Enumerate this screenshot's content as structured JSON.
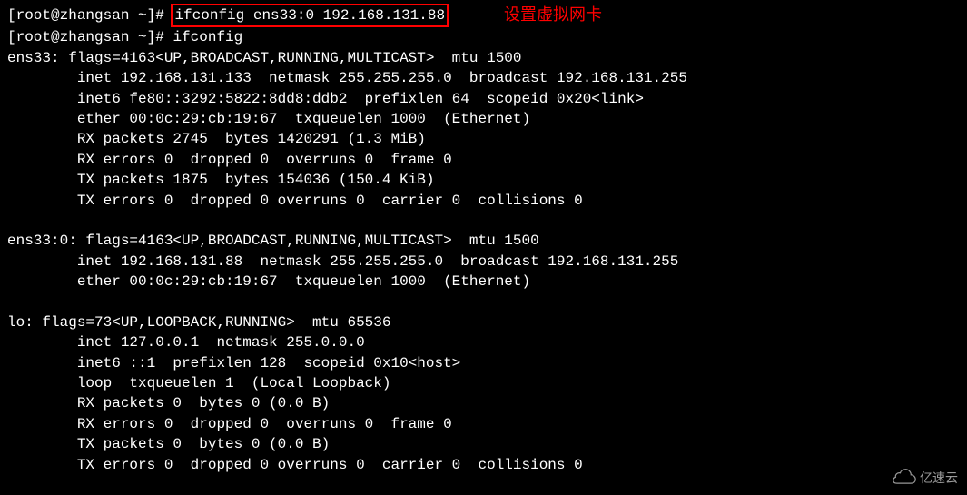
{
  "annotation": "设置虚拟网卡",
  "prompt_prefix": "[root@zhangsan ~]# ",
  "cmd1": "ifconfig ens33:0 192.168.131.88",
  "cmd2": "ifconfig",
  "ens33": {
    "header": "ens33: flags=4163<UP,BROADCAST,RUNNING,MULTICAST>  mtu 1500",
    "inet": "inet 192.168.131.133  netmask 255.255.255.0  broadcast 192.168.131.255",
    "inet6": "inet6 fe80::3292:5822:8dd8:ddb2  prefixlen 64  scopeid 0x20<link>",
    "ether": "ether 00:0c:29:cb:19:67  txqueuelen 1000  (Ethernet)",
    "rxp": "RX packets 2745  bytes 1420291 (1.3 MiB)",
    "rxe": "RX errors 0  dropped 0  overruns 0  frame 0",
    "txp": "TX packets 1875  bytes 154036 (150.4 KiB)",
    "txe": "TX errors 0  dropped 0 overruns 0  carrier 0  collisions 0"
  },
  "ens33_0": {
    "header": "ens33:0: flags=4163<UP,BROADCAST,RUNNING,MULTICAST>  mtu 1500",
    "inet": "inet 192.168.131.88  netmask 255.255.255.0  broadcast 192.168.131.255",
    "ether": "ether 00:0c:29:cb:19:67  txqueuelen 1000  (Ethernet)"
  },
  "lo": {
    "header": "lo: flags=73<UP,LOOPBACK,RUNNING>  mtu 65536",
    "inet": "inet 127.0.0.1  netmask 255.0.0.0",
    "inet6": "inet6 ::1  prefixlen 128  scopeid 0x10<host>",
    "loop": "loop  txqueuelen 1  (Local Loopback)",
    "rxp": "RX packets 0  bytes 0 (0.0 B)",
    "rxe": "RX errors 0  dropped 0  overruns 0  frame 0",
    "txp": "TX packets 0  bytes 0 (0.0 B)",
    "txe": "TX errors 0  dropped 0 overruns 0  carrier 0  collisions 0"
  },
  "watermark_text": "亿速云"
}
